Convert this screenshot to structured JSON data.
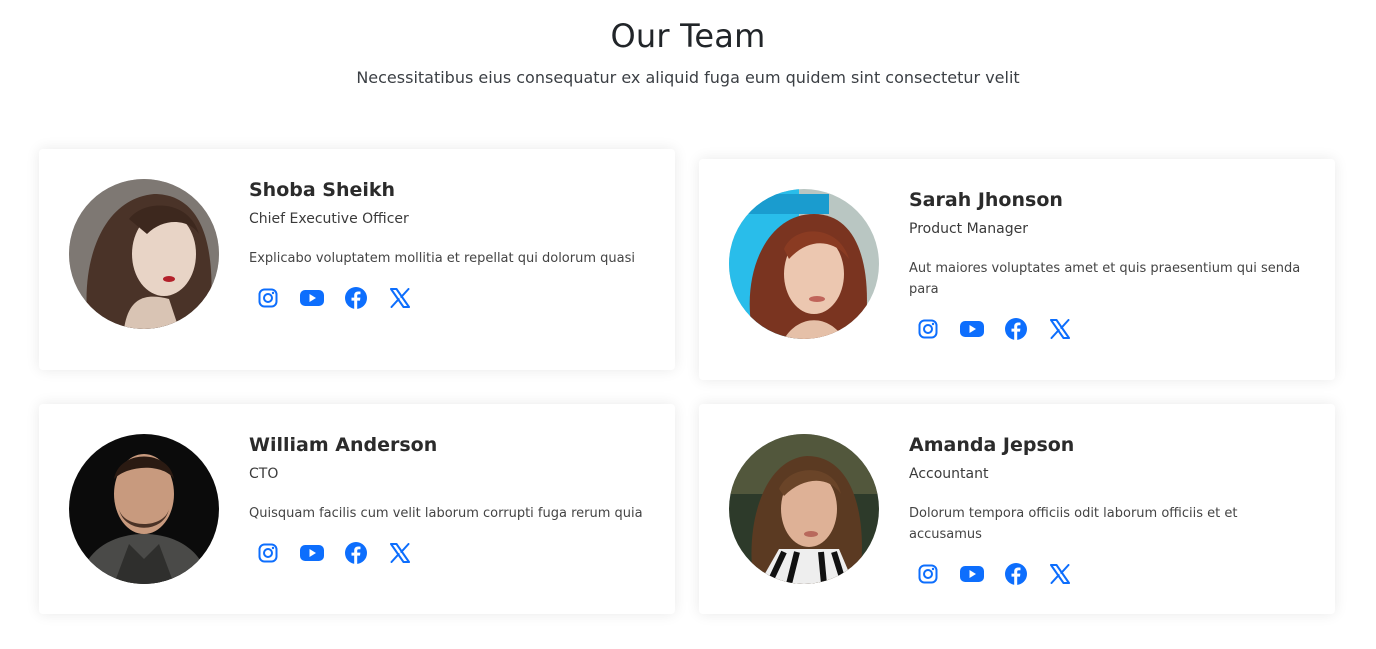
{
  "section": {
    "title": "Our Team",
    "subtitle": "Necessitatibus eius consequatur ex aliquid fuga eum quidem sint consectetur velit"
  },
  "colors": {
    "accent": "#0d6efd",
    "text": "#212529"
  },
  "members": [
    {
      "name": "Shoba Sheikh",
      "role": "Chief Executive Officer",
      "description": "Explicabo voluptatem mollitia et repellat qui dolorum quasi",
      "socials": [
        "instagram-icon",
        "youtube-icon",
        "facebook-icon",
        "x-icon"
      ]
    },
    {
      "name": "Sarah Jhonson",
      "role": "Product Manager",
      "description": "Aut maiores voluptates amet et quis praesentium qui senda para",
      "socials": [
        "instagram-icon",
        "youtube-icon",
        "facebook-icon",
        "x-icon"
      ]
    },
    {
      "name": "William Anderson",
      "role": "CTO",
      "description": "Quisquam facilis cum velit laborum corrupti fuga rerum quia",
      "socials": [
        "instagram-icon",
        "youtube-icon",
        "facebook-icon",
        "x-icon"
      ]
    },
    {
      "name": "Amanda Jepson",
      "role": "Accountant",
      "description": "Dolorum tempora officiis odit laborum officiis et et accusamus",
      "socials": [
        "instagram-icon",
        "youtube-icon",
        "facebook-icon",
        "x-icon"
      ]
    }
  ]
}
